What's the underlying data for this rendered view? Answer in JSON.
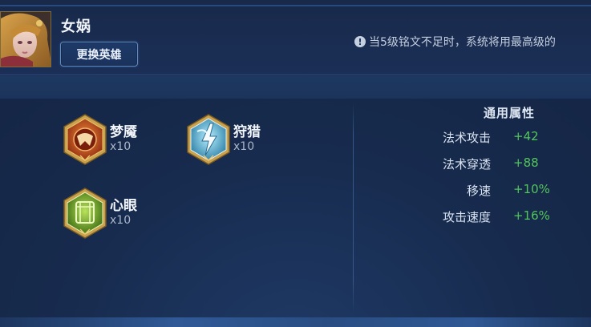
{
  "hero": {
    "name": "女娲",
    "change_button": "更换英雄"
  },
  "notice": {
    "icon": "info-icon",
    "text": "当5级铭文不足时，系统将用最高级的"
  },
  "runes": [
    {
      "name": "梦魇",
      "count": "x10",
      "icon": "nightmare-rune-icon",
      "color": "#c85a1e"
    },
    {
      "name": "狩猎",
      "count": "x10",
      "icon": "hunting-rune-icon",
      "color": "#4fb7d4"
    },
    {
      "name": "心眼",
      "count": "x10",
      "icon": "mind-eye-rune-icon",
      "color": "#6fae2a"
    }
  ],
  "attributes": {
    "title": "通用属性",
    "rows": [
      {
        "label": "法术攻击",
        "value": "+42"
      },
      {
        "label": "法术穿透",
        "value": "+88"
      },
      {
        "label": "移速",
        "value": "+10%"
      },
      {
        "label": "攻击速度",
        "value": "+16%"
      }
    ]
  },
  "colors": {
    "background": "#172b4e",
    "positive_value": "#52c55a",
    "button_border": "#5c8cc6"
  }
}
